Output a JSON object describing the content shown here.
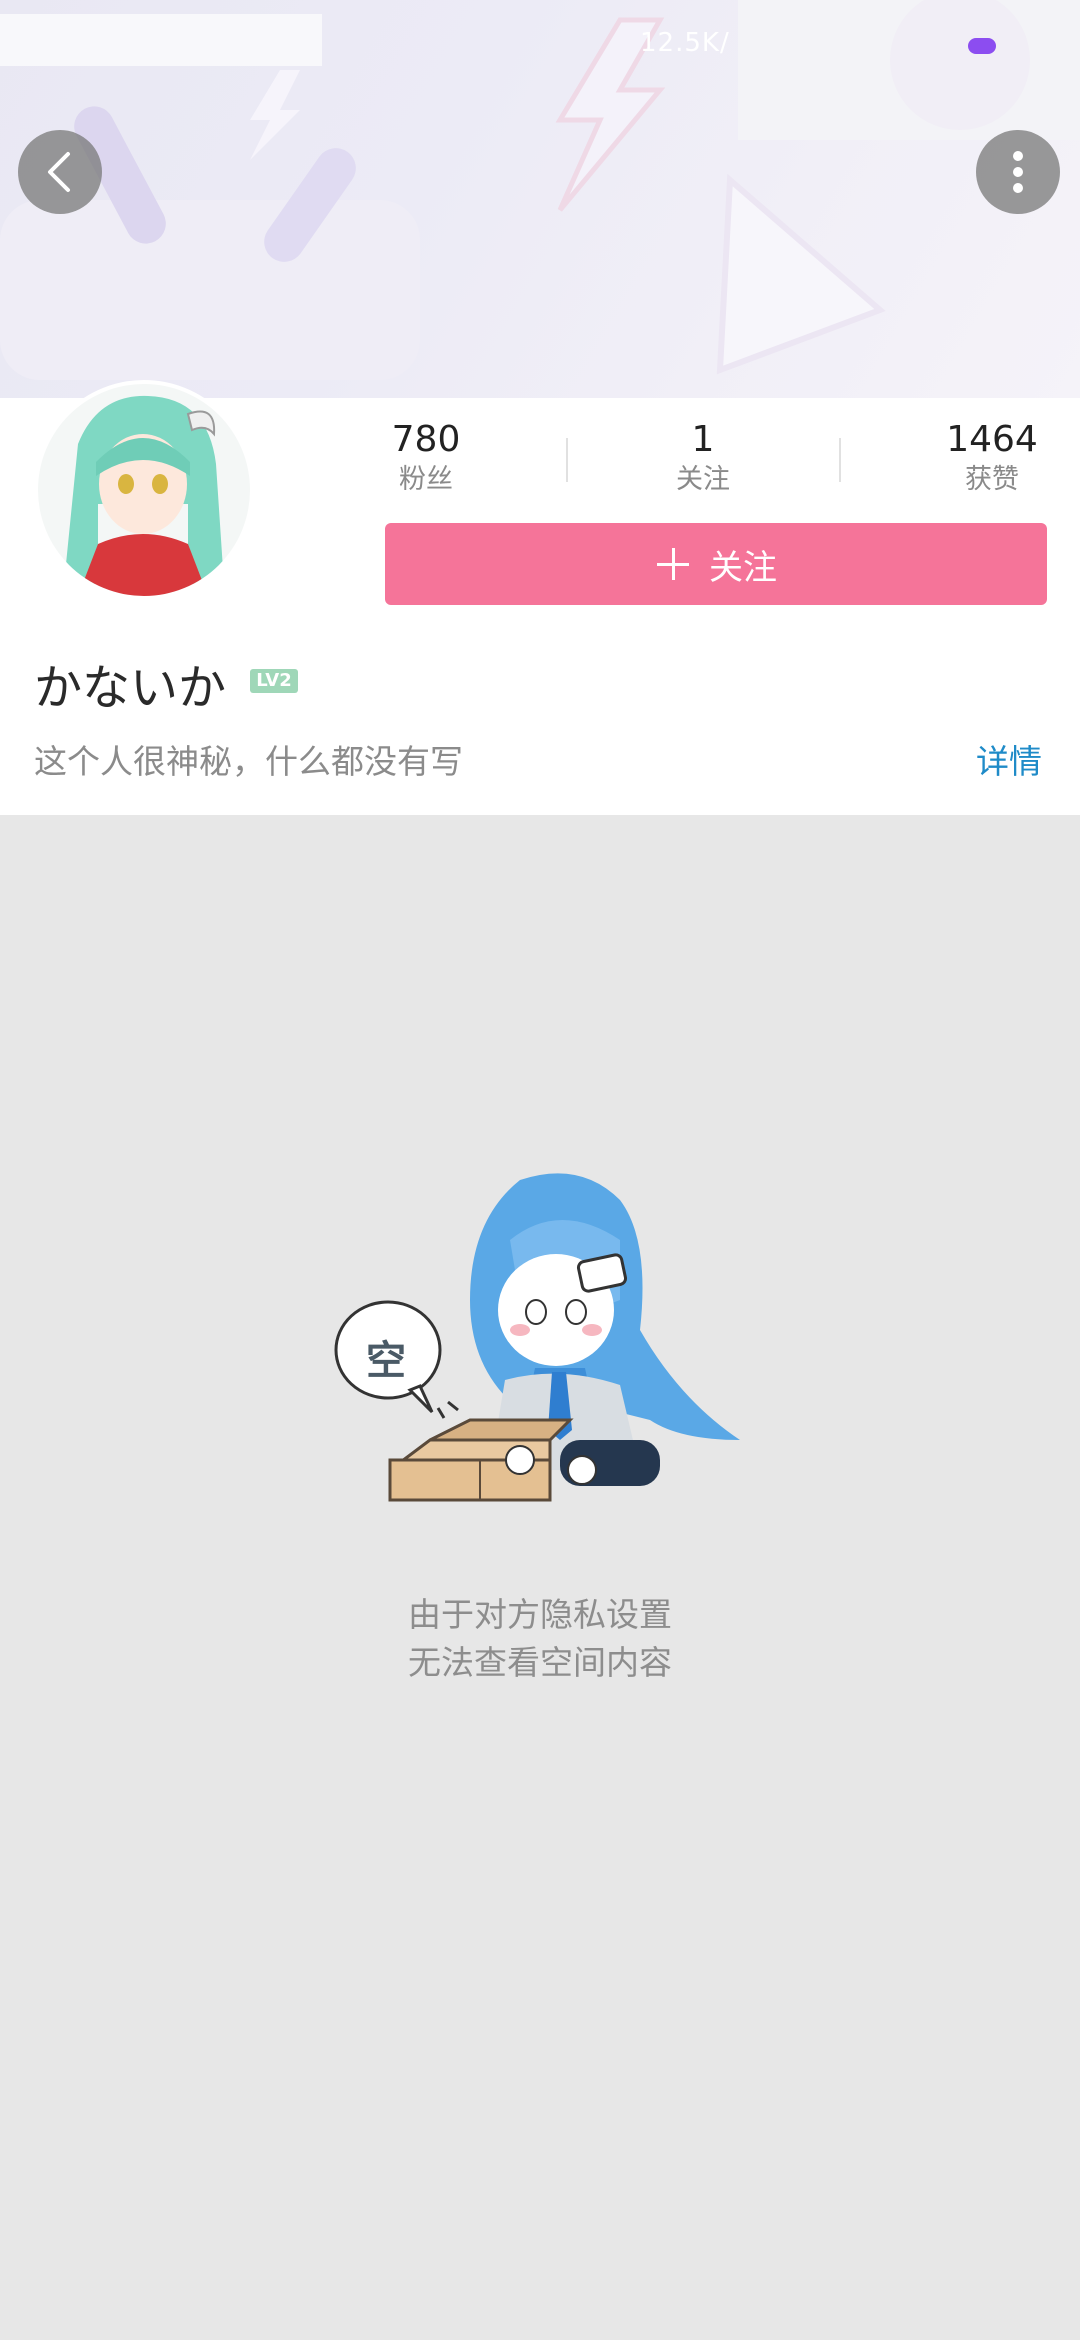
{
  "statusbar": {
    "net_speed": "12.5K/"
  },
  "profile": {
    "stats": [
      {
        "value": "780",
        "label": "粉丝"
      },
      {
        "value": "1",
        "label": "关注"
      },
      {
        "value": "1464",
        "label": "获赞"
      }
    ],
    "follow_label": "关注",
    "username": "かないか",
    "level": "LV2",
    "bio": "这个人很神秘，什么都没有写",
    "detail_link": "详情"
  },
  "empty": {
    "bubble_text": "空",
    "line1": "由于对方隐私设置",
    "line2": "无法查看空间内容"
  },
  "colors": {
    "follow_button": "#f57499",
    "link": "#1f8bc8",
    "level_badge": "#9fd7b8",
    "page_background": "#e7e7e7",
    "battery": "#8c4df0"
  },
  "icons": {
    "back": "back-icon",
    "more": "more-vertical-icon",
    "plus": "plus-icon"
  }
}
